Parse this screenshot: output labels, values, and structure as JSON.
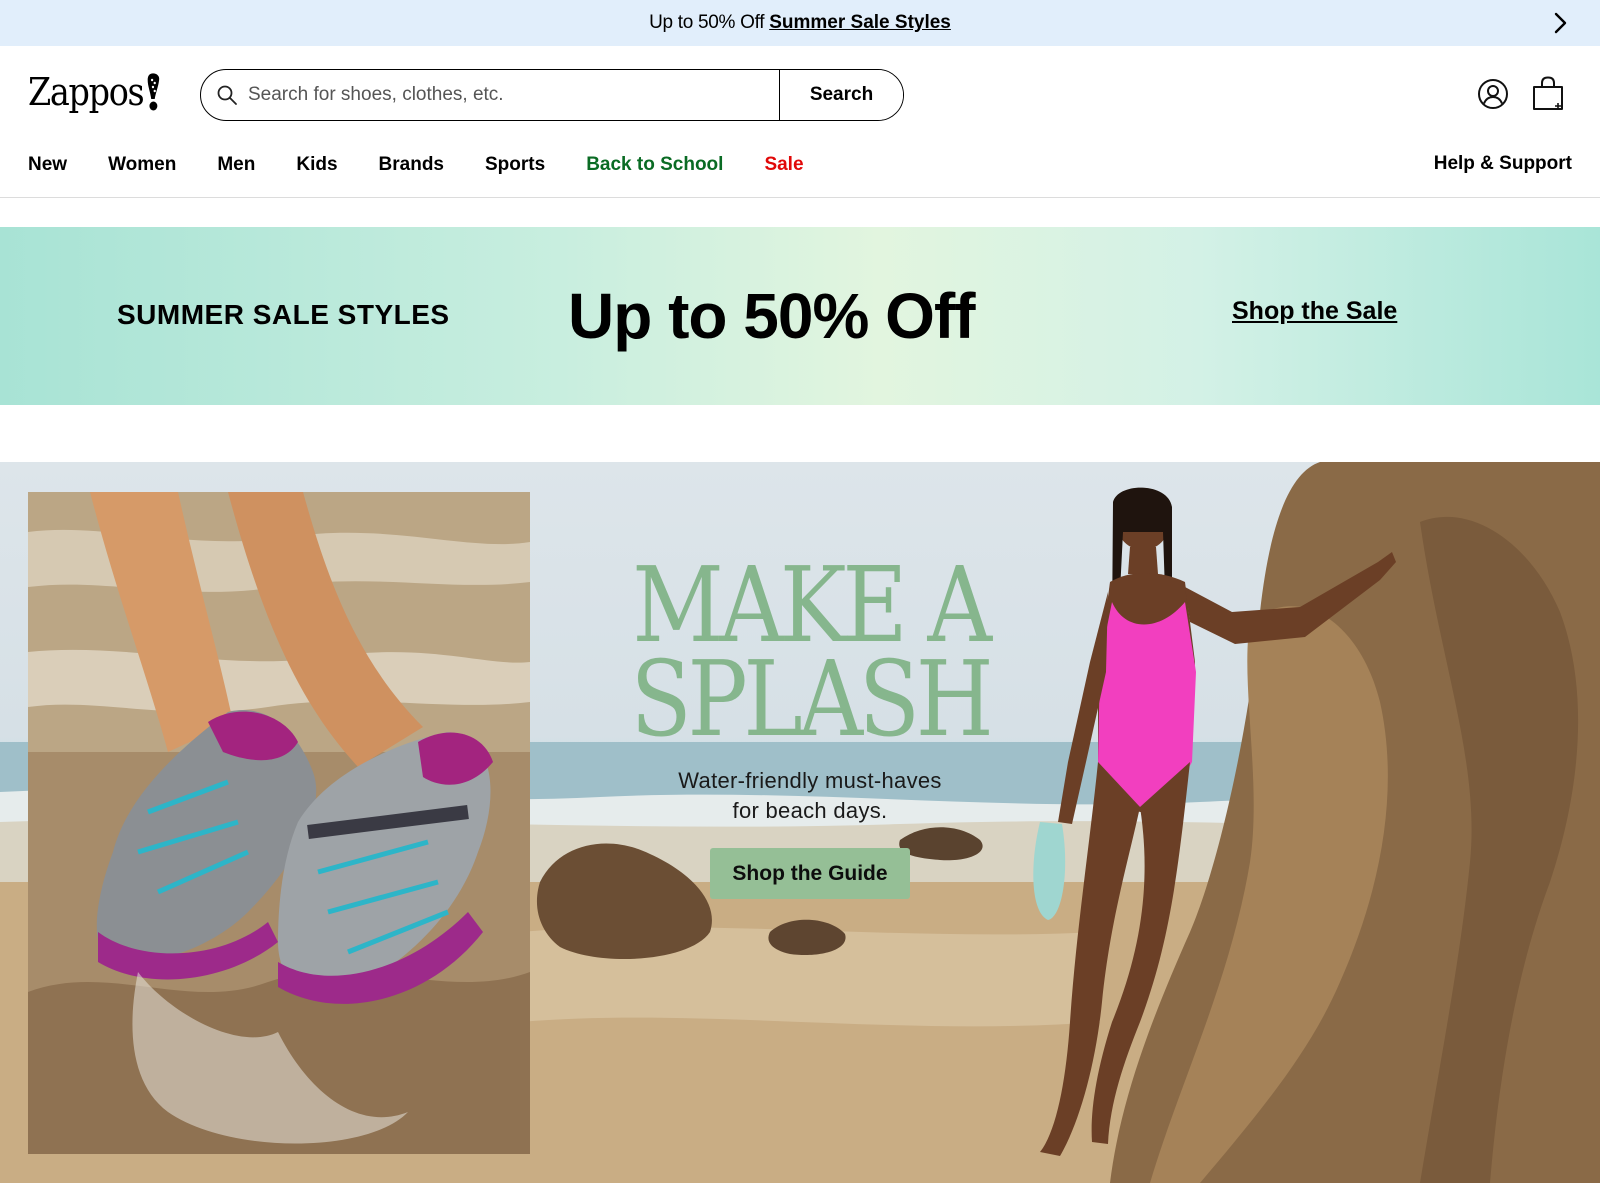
{
  "promo_bar": {
    "text": "Up to 50% Off",
    "link": "Summer Sale Styles",
    "next_icon": "chevron-right-icon"
  },
  "header": {
    "logo": "Zappos",
    "search": {
      "placeholder": "Search for shoes, clothes, etc.",
      "value": "",
      "button_label": "Search",
      "icon": "search-icon"
    },
    "account_icon": "user-icon",
    "cart_icon": "shopping-bag-icon",
    "nav": {
      "items": [
        {
          "label": "New"
        },
        {
          "label": "Women"
        },
        {
          "label": "Men"
        },
        {
          "label": "Kids"
        },
        {
          "label": "Brands"
        },
        {
          "label": "Sports"
        },
        {
          "label": "Back to School",
          "color": "#0a6b24"
        },
        {
          "label": "Sale",
          "color": "#e10808"
        }
      ],
      "help": "Help & Support"
    }
  },
  "sale_banner": {
    "eyebrow": "SUMMER SALE STYLES",
    "headline": "Up to 50% Off",
    "cta": "Shop the Sale"
  },
  "hero": {
    "title_line1": "MAKE A",
    "title_line2": "SPLASH",
    "subtitle_line1": "Water-friendly must-haves",
    "subtitle_line2": "for beach days.",
    "button": "Shop the Guide",
    "title_color": "#86b68d",
    "button_color": "#95bf96"
  }
}
